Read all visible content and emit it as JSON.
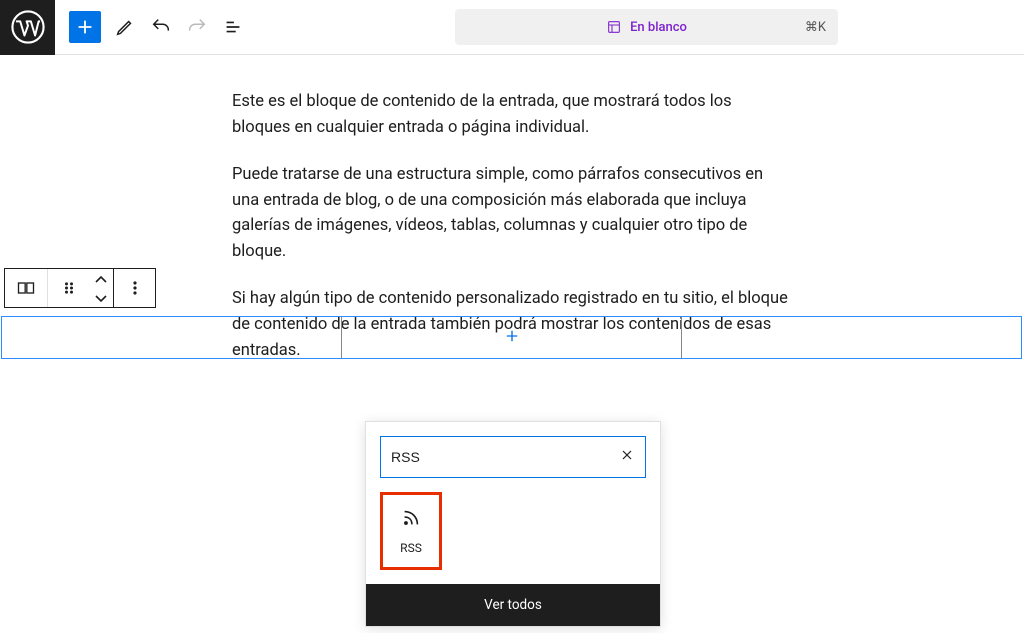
{
  "template_pill": {
    "label": "En blanco",
    "shortcut": "⌘K"
  },
  "content": {
    "p1": "Este es el bloque de contenido de la entrada, que mostrará todos los bloques en cualquier entrada o página individual.",
    "p2": "Puede tratarse de una estructura simple, como párrafos consecutivos en una entrada de blog, o de una composición más elaborada que incluya galerías de imágenes, vídeos, tablas, columnas y cualquier otro tipo de bloque.",
    "p3": "Si hay algún tipo de contenido personalizado registrado en tu sitio, el bloque de contenido de la entrada también podrá mostrar los contenidos de esas entradas."
  },
  "inserter": {
    "search_value": "RSS",
    "results": [
      {
        "label": "RSS"
      }
    ],
    "footer_label": "Ver todos"
  }
}
